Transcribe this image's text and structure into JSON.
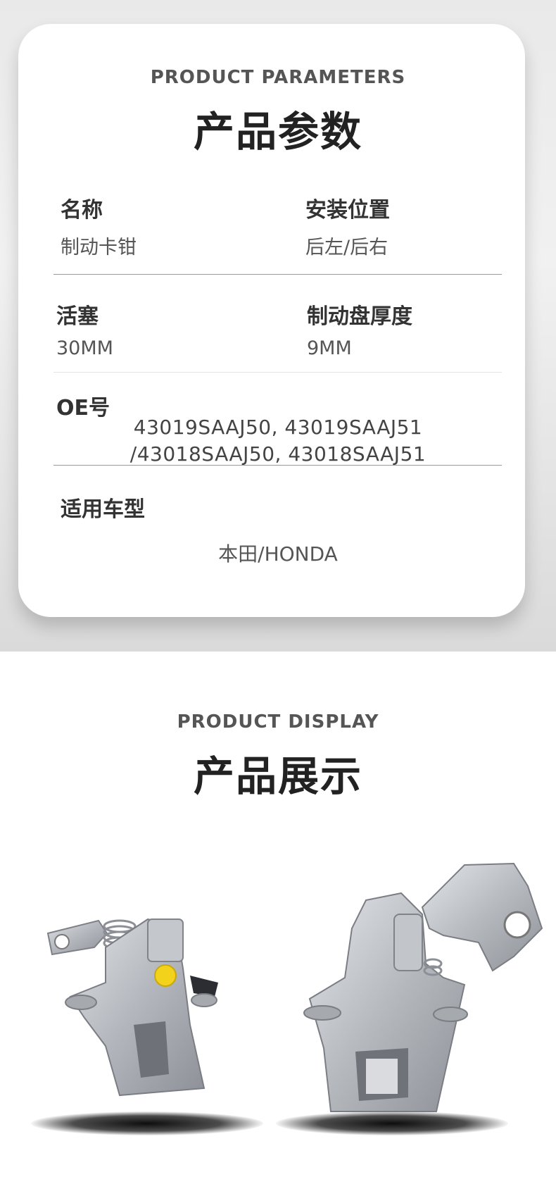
{
  "parameters": {
    "title_en": "PRODUCT PARAMETERS",
    "title_cn": "产品参数",
    "name_label": "名称",
    "name_value": "制动卡钳",
    "position_label": "安装位置",
    "position_value": "后左/后右",
    "piston_label": "活塞",
    "piston_value": "30MM",
    "disc_label": "制动盘厚度",
    "disc_value": "9MM",
    "oe_label": "OE号",
    "oe_line1": "43019SAAJ50, 43019SAAJ51",
    "oe_line2": "/43018SAAJ50, 43018SAAJ51",
    "vehicle_label": "适用车型",
    "vehicle_value": "本田/HONDA"
  },
  "display": {
    "title_en": "PRODUCT DISPLAY",
    "title_cn": "产品展示",
    "photos": [
      "brake-caliper-left-photo",
      "brake-caliper-right-photo"
    ],
    "caliper_color": "#b9bcc1",
    "cap_color": "#f2d21a"
  }
}
